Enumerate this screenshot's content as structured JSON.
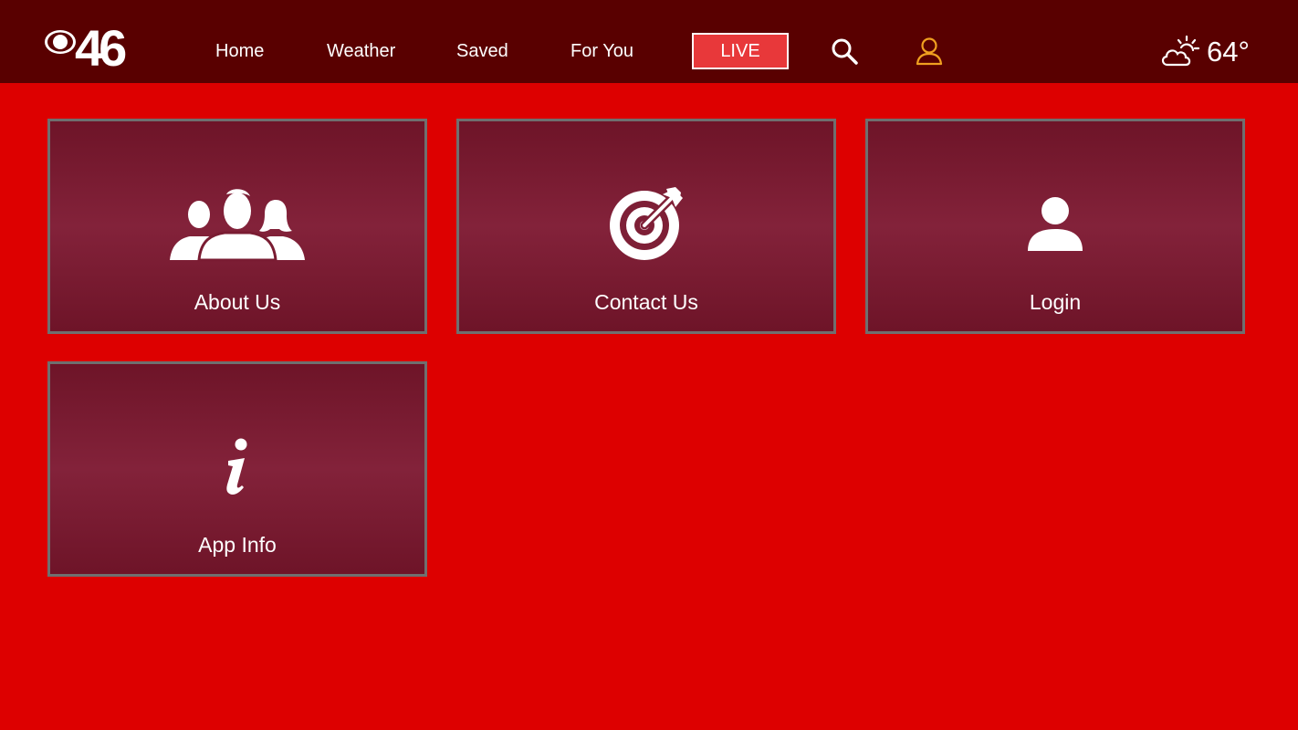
{
  "header": {
    "logo": "CBS 46",
    "nav": {
      "home": "Home",
      "weather": "Weather",
      "saved": "Saved",
      "for_you": "For You",
      "live": "LIVE"
    },
    "search_icon": "search-icon",
    "account_icon": "user-icon",
    "weather_widget": {
      "icon": "partly-cloudy-icon",
      "temperature": "64°"
    }
  },
  "tiles": [
    {
      "label": "About Us",
      "icon": "group-icon"
    },
    {
      "label": "Contact Us",
      "icon": "target-icon"
    },
    {
      "label": "Login",
      "icon": "user-icon"
    },
    {
      "label": "App Info",
      "icon": "info-icon"
    }
  ],
  "colors": {
    "background": "#dd0000",
    "topbar": "#590000",
    "live_button": "#e8383a",
    "account_icon": "#f0a020",
    "tile_border": "#6f6f6f"
  }
}
